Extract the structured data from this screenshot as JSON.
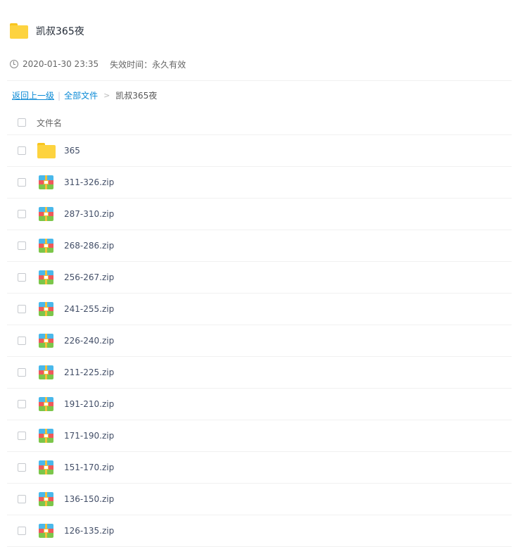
{
  "share": {
    "title": "凯叔365夜",
    "date": "2020-01-30 23:35",
    "expire_label": "失效时间：",
    "expire_value": "永久有效"
  },
  "breadcrumb": {
    "back": "返回上一级",
    "sep": "|",
    "all_files": "全部文件",
    "arrow": ">",
    "current": "凯叔365夜"
  },
  "list": {
    "header": "文件名",
    "items": [
      {
        "name": "365",
        "icon": "folder-icon"
      },
      {
        "name": "311-326.zip",
        "icon": "zip-icon"
      },
      {
        "name": "287-310.zip",
        "icon": "zip-icon"
      },
      {
        "name": "268-286.zip",
        "icon": "zip-icon"
      },
      {
        "name": "256-267.zip",
        "icon": "zip-icon"
      },
      {
        "name": "241-255.zip",
        "icon": "zip-icon"
      },
      {
        "name": "226-240.zip",
        "icon": "zip-icon"
      },
      {
        "name": "211-225.zip",
        "icon": "zip-icon"
      },
      {
        "name": "191-210.zip",
        "icon": "zip-icon"
      },
      {
        "name": "171-190.zip",
        "icon": "zip-icon"
      },
      {
        "name": "151-170.zip",
        "icon": "zip-icon"
      },
      {
        "name": "136-150.zip",
        "icon": "zip-icon"
      },
      {
        "name": "126-135.zip",
        "icon": "zip-icon"
      }
    ]
  }
}
